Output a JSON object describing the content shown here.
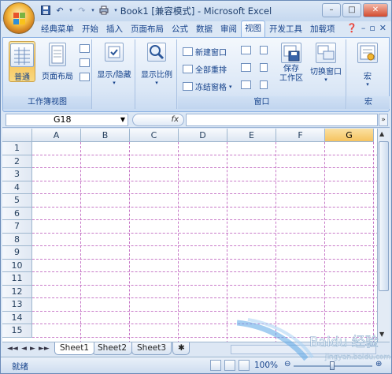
{
  "window": {
    "title": "Book1  [兼容模式] - Microsoft Excel"
  },
  "tabs": [
    "经典菜单",
    "开始",
    "插入",
    "页面布局",
    "公式",
    "数据",
    "审阅",
    "视图",
    "开发工具",
    "加载项"
  ],
  "active_tab": "视图",
  "ribbon": {
    "workbook_views": {
      "label": "工作簿视图",
      "normal": "普通",
      "page_layout": "页面布局"
    },
    "show_hide": "显示/隐藏",
    "zoom": "显示比例",
    "window_group": {
      "label": "窗口",
      "new_window": "新建窗口",
      "arrange_all": "全部重排",
      "freeze_panes": "冻结窗格",
      "save_workspace": "保存\n工作区",
      "save_workspace_line1": "保存",
      "save_workspace_line2": "工作区",
      "switch_windows": "切换窗口"
    },
    "macros": {
      "label": "宏",
      "button": "宏"
    }
  },
  "formula_bar": {
    "name_box": "G18",
    "fx": "fx",
    "value": ""
  },
  "columns": [
    "A",
    "B",
    "C",
    "D",
    "E",
    "F",
    "G"
  ],
  "selected_column": "G",
  "rows": [
    "1",
    "2",
    "3",
    "4",
    "5",
    "6",
    "7",
    "8",
    "9",
    "10",
    "11",
    "12",
    "13",
    "14",
    "15"
  ],
  "sheets": [
    "Sheet1",
    "Sheet2",
    "Sheet3"
  ],
  "active_sheet": "Sheet1",
  "status": {
    "ready": "就绪",
    "zoom": "100%"
  },
  "colors": {
    "ribbon": "#dbe7f5",
    "page_break": "#c87ac8",
    "selected_header": "#f6c35f"
  }
}
